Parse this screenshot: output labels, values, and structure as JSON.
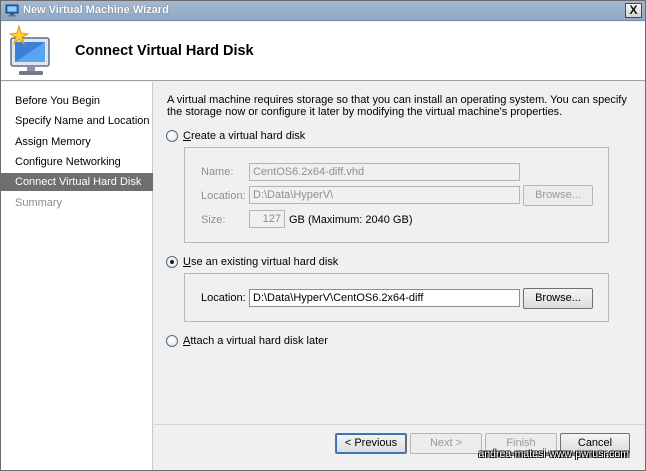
{
  "window": {
    "title": "New Virtual Machine Wizard",
    "close_glyph": "X",
    "icon": "wizard-computer-icon"
  },
  "header": {
    "title": "Connect Virtual Hard Disk",
    "icon": "monitor-sparkle-icon"
  },
  "nav": {
    "items": [
      {
        "label": "Before You Begin",
        "state": "normal"
      },
      {
        "label": "Specify Name and Location",
        "state": "normal"
      },
      {
        "label": "Assign Memory",
        "state": "normal"
      },
      {
        "label": "Configure Networking",
        "state": "normal"
      },
      {
        "label": "Connect Virtual Hard Disk",
        "state": "active"
      },
      {
        "label": "Summary",
        "state": "disabled"
      }
    ]
  },
  "main": {
    "description": "A virtual machine requires storage so that you can install an operating system. You can specify the storage now or configure it later by modifying the virtual machine's properties.",
    "create_option": {
      "label_prefix": "",
      "label_accel": "C",
      "label_rest": "reate a virtual hard disk",
      "checked": false,
      "name_label": "Name:",
      "name_value": "CentOS6.2x64-diff.vhd",
      "location_label": "Location:",
      "location_value": "D:\\Data\\HyperV\\",
      "browse_label": "Browse...",
      "size_label": "Size:",
      "size_value": "127",
      "size_unit": "GB (Maximum: 2040 GB)"
    },
    "existing_option": {
      "label_prefix": "",
      "label_accel": "U",
      "label_rest": "se an existing virtual hard disk",
      "checked": true,
      "location_label": "Location:",
      "location_value": "D:\\Data\\HyperV\\CentOS6.2x64-diff",
      "browse_label": "Browse..."
    },
    "later_option": {
      "label_prefix": "",
      "label_accel": "A",
      "label_rest": "ttach a virtual hard disk later",
      "checked": false
    }
  },
  "footer": {
    "previous_label": "< Previous",
    "next_label": "Next >",
    "finish_label": "Finish",
    "cancel_label": "Cancel",
    "watermark": "andrea-matesi-www-pwrusr.com"
  },
  "colors": {
    "titlebar": "#8ea7c4",
    "nav_active": "#6f6f6f",
    "disabled_text": "#8f8f8f"
  }
}
